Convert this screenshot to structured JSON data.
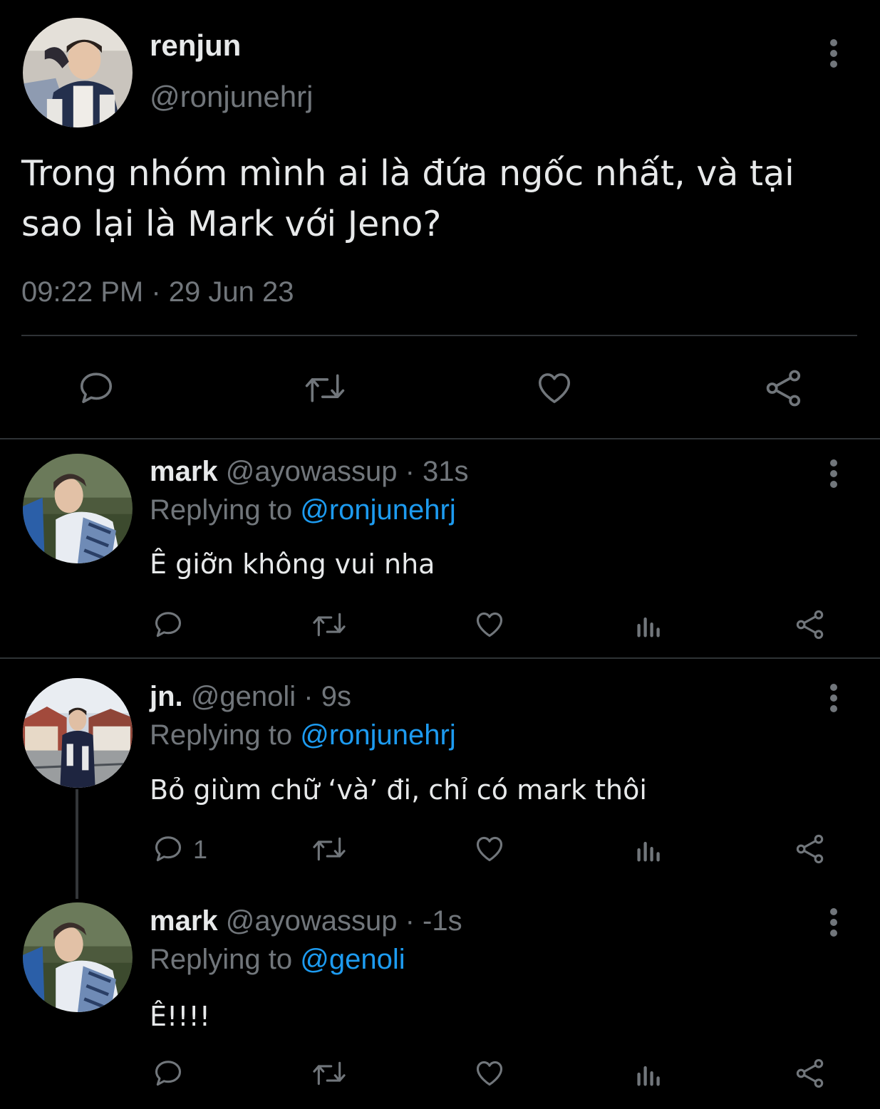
{
  "main_tweet": {
    "display_name": "renjun",
    "handle": "@ronjunehrj",
    "text": "Trong nhóm mình ai là đứa ngốc nhất, và tại sao lại là Mark với Jeno?",
    "timestamp": "09:22 PM · 29 Jun 23",
    "avatar_icon": "avatar-renjun",
    "actions": [
      "reply-icon",
      "retweet-icon",
      "like-icon",
      "share-icon"
    ]
  },
  "replies": [
    {
      "display_name": "mark",
      "handle": "@ayowassup",
      "time": "· 31s",
      "replying_prefix": "Replying to",
      "replying_to": "@ronjunehrj",
      "text": "Ê giỡn không vui nha",
      "reply_count": "",
      "avatar_icon": "avatar-mark"
    },
    {
      "display_name": "jn.",
      "handle": "@genoli",
      "time": "· 9s",
      "replying_prefix": "Replying to",
      "replying_to": "@ronjunehrj",
      "text": "Bỏ giùm chữ ‘và’ đi, chỉ có mark thôi",
      "reply_count": "1",
      "avatar_icon": "avatar-jn"
    },
    {
      "display_name": "mark",
      "handle": "@ayowassup",
      "time": "· -1s",
      "replying_prefix": "Replying to",
      "replying_to": "@genoli",
      "text": "Ê!!!!",
      "reply_count": "",
      "avatar_icon": "avatar-mark"
    }
  ],
  "colors": {
    "background": "#000000",
    "text": "#e7e9ea",
    "muted": "#71767b",
    "link": "#1d9bf0",
    "divider": "#2f3336"
  }
}
